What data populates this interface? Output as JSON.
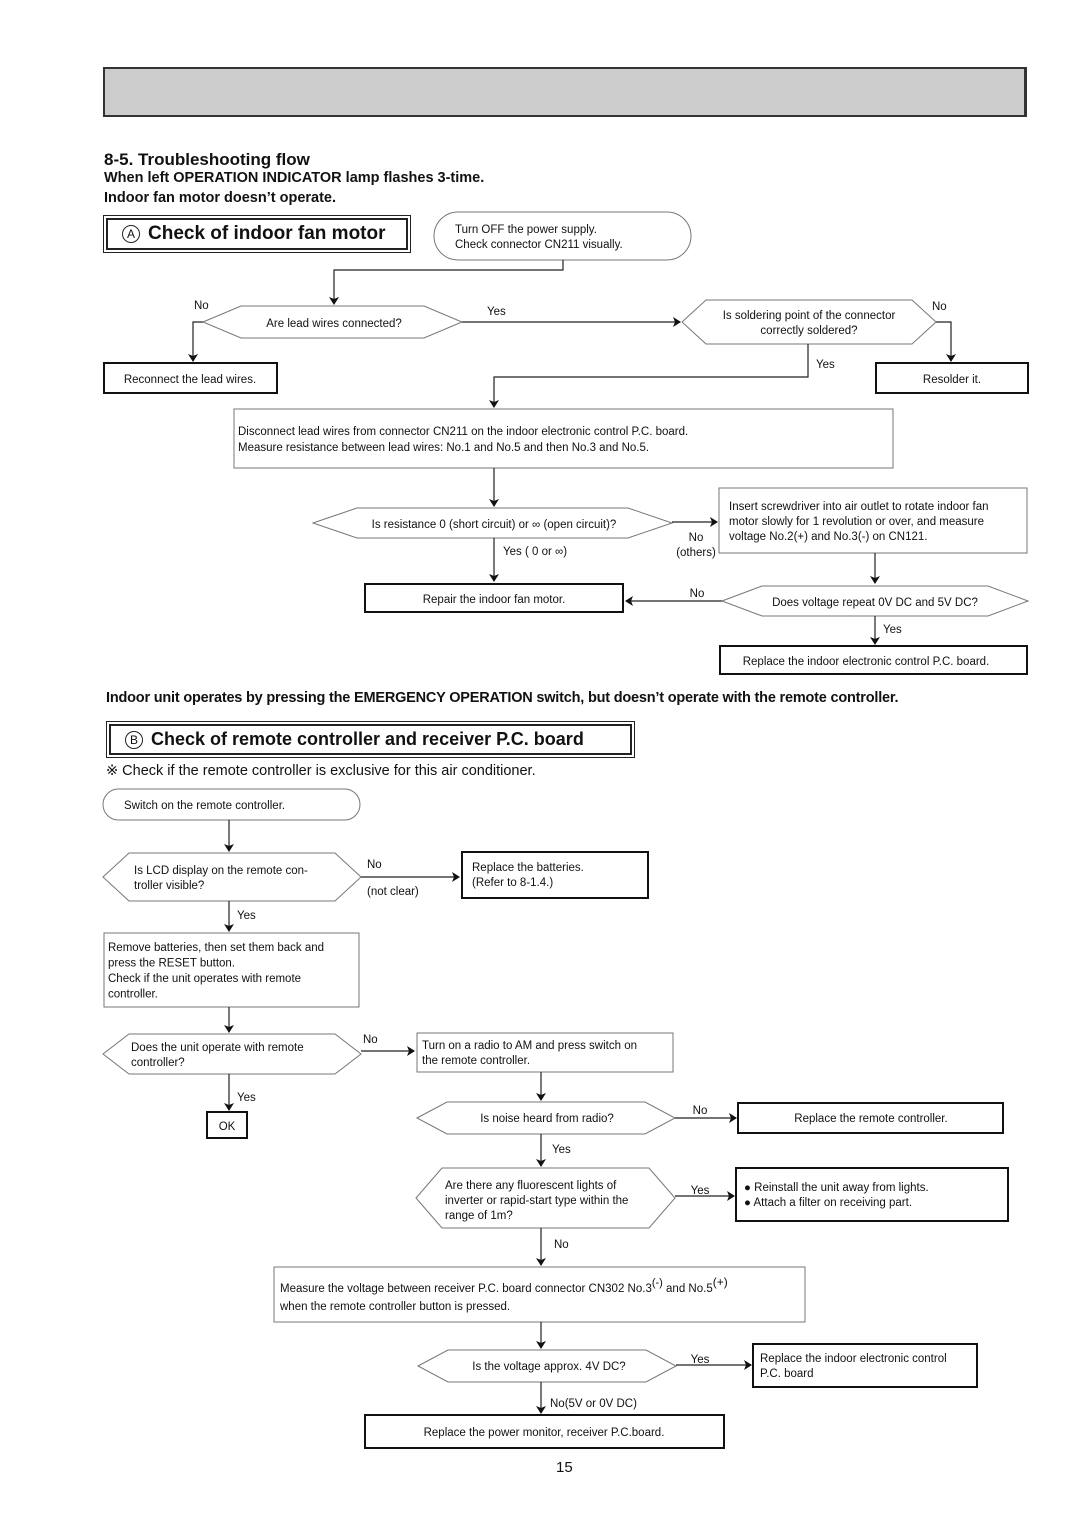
{
  "header": {
    "section_title": "8-5. Troubleshooting flow",
    "subtitle_1": "When left OPERATION INDICATOR lamp flashes 3-time.",
    "subtitle_2": "Indoor fan motor doesn’t operate."
  },
  "section_a": {
    "badge": "A",
    "title": "Check of indoor fan motor",
    "nodes": {
      "start": [
        "Turn OFF the power supply.",
        "Check connector CN211 visually."
      ],
      "q_lead": [
        "Are lead wires connected?"
      ],
      "reconnect": [
        "Reconnect the lead wires."
      ],
      "q_solder": [
        "Is soldering point of the connector",
        "correctly soldered?"
      ],
      "resolder": [
        "Resolder it."
      ],
      "disconnect": [
        "Disconnect lead wires from connector CN211 on the indoor electronic control P.C. board.",
        "Measure resistance between lead wires: No.1 and No.5 and then No.3 and No.5."
      ],
      "q_resistance": [
        "Is resistance 0 (short circuit) or ∞ (open circuit)?"
      ],
      "screwdriver": [
        "Insert screwdriver into air outlet to rotate indoor fan",
        "motor slowly for 1 revolution or over, and measure",
        "voltage No.2(+) and No.3(-) on CN121."
      ],
      "repair_motor": [
        "Repair the indoor fan motor."
      ],
      "q_voltage": [
        "Does voltage repeat 0V DC and 5V DC?"
      ],
      "replace_pcb": [
        "Replace the indoor electronic control P.C. board."
      ]
    },
    "labels": {
      "lead_no": "No",
      "lead_yes": "Yes",
      "solder_no": "No",
      "solder_yes": "Yes",
      "res_yes": "Yes ( 0 or ∞)",
      "res_no": "No",
      "res_no_sub": "(others)",
      "volt_no": "No",
      "volt_yes": "Yes"
    }
  },
  "emergency_text": "Indoor unit operates by pressing the EMERGENCY OPERATION switch, but doesn’t operate with the remote controller.",
  "section_b": {
    "badge": "B",
    "title": "Check of remote controller and receiver P.C. board",
    "note": "※  Check if the remote controller is exclusive for this air conditioner.",
    "nodes": {
      "start": [
        "Switch on the remote controller."
      ],
      "q_lcd": [
        "Is LCD display on the remote con-",
        "troller visible?"
      ],
      "batteries": [
        "Replace the batteries.",
        "(Refer to 8-1.4.)"
      ],
      "reset": [
        "Remove batteries, then set them back and",
        "press the RESET button.",
        "Check if the unit operates with remote",
        "controller."
      ],
      "q_operate": [
        "Does the unit operate with remote",
        "controller?"
      ],
      "ok": [
        "OK"
      ],
      "radio": [
        "Turn on a radio to AM and press switch on",
        "the remote controller."
      ],
      "q_noise": [
        "Is noise heard from radio?"
      ],
      "replace_remote": [
        "Replace the remote controller."
      ],
      "q_fluor": [
        "Are there any fluorescent lights of",
        "inverter or rapid-start type within the",
        "range of 1m?"
      ],
      "reinstall": [
        "● Reinstall the unit away from lights.",
        "● Attach a filter on receiving part."
      ],
      "measure": [
        "Measure the voltage between receiver P.C. board connector CN302 No.3",
        "when the remote controller button is pressed."
      ],
      "measure_sup_minus": "(-)",
      "measure_mid": "and No.5",
      "measure_sup_plus": "(+)",
      "q_4v": [
        "Is the voltage approx. 4V DC?"
      ],
      "replace_indoor": [
        "Replace the indoor electronic control",
        "P.C. board"
      ],
      "replace_power": [
        "Replace the power monitor, receiver P.C.board."
      ]
    },
    "labels": {
      "lcd_no": "No",
      "lcd_no_sub": "(not clear)",
      "lcd_yes": "Yes",
      "op_no": "No",
      "op_yes": "Yes",
      "noise_no": "No",
      "noise_yes": "Yes",
      "fluor_yes": "Yes",
      "fluor_no": "No",
      "v4_yes": "Yes",
      "v4_no": "No(5V or 0V DC)"
    }
  },
  "page_number": "15"
}
